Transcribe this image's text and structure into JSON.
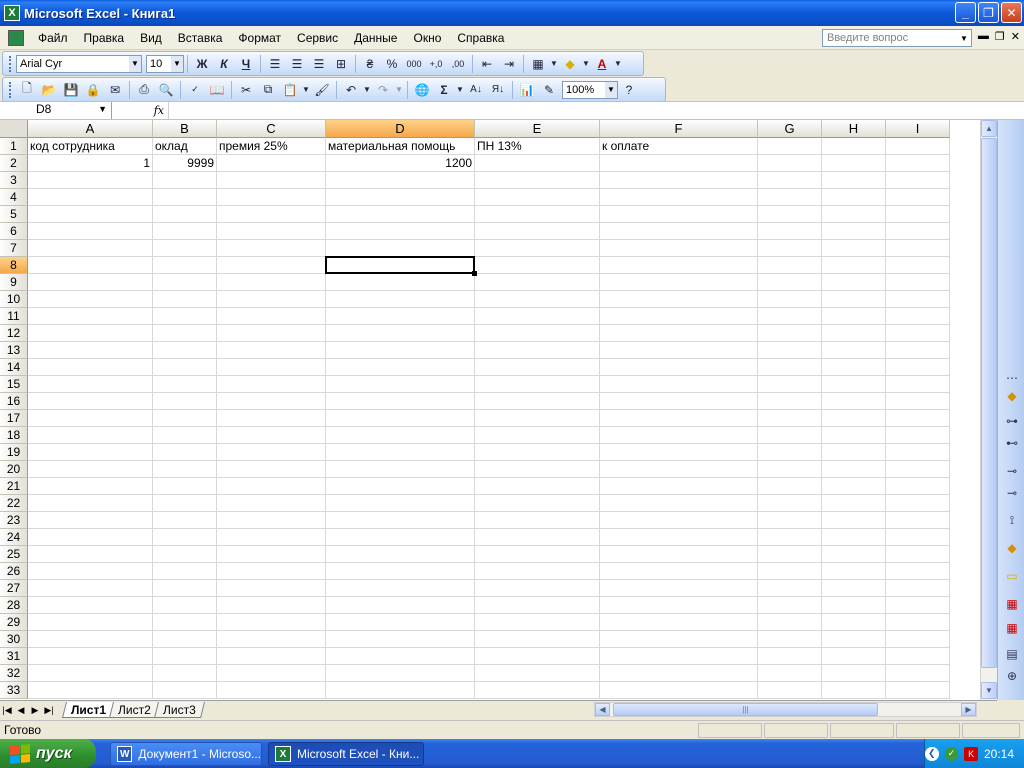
{
  "window": {
    "title": "Microsoft Excel - Книга1"
  },
  "menu": {
    "items": [
      "Файл",
      "Правка",
      "Вид",
      "Вставка",
      "Формат",
      "Сервис",
      "Данные",
      "Окно",
      "Справка"
    ],
    "help_placeholder": "Введите вопрос"
  },
  "format_toolbar": {
    "font": "Arial Cyr",
    "size": "10",
    "bold": "Ж",
    "italic": "К",
    "underline": "Ч",
    "percent": "%",
    "thousands": "000",
    "inc_decimal": "+,0",
    "dec_decimal": ",00",
    "font_color_glyph": "A"
  },
  "standard_toolbar": {
    "zoom": "100%",
    "sum_glyph": "Σ"
  },
  "formula_bar": {
    "name_box": "D8",
    "fx_label": "fx",
    "formula": ""
  },
  "sheet": {
    "columns": [
      "A",
      "B",
      "C",
      "D",
      "E",
      "F",
      "G",
      "H",
      "I"
    ],
    "active_column": "D",
    "active_row": 8,
    "row_count": 33,
    "cells": {
      "A1": "код сотрудника",
      "B1": "оклад",
      "C1": "премия 25%",
      "D1": "материальная помощь",
      "E1": "ПН 13%",
      "F1": "к оплате",
      "A2": "1",
      "B2": "9999",
      "D2": "1200"
    }
  },
  "tabs": [
    "Лист1",
    "Лист2",
    "Лист3"
  ],
  "active_tab": "Лист1",
  "status": {
    "text": "Готово"
  },
  "taskbar": {
    "start_label": "пуск",
    "buttons": [
      {
        "label": "Документ1 - Microso...",
        "icon": "W"
      },
      {
        "label": "Microsoft Excel - Кни...",
        "icon": "X"
      }
    ],
    "clock": "20:14"
  },
  "colors": {
    "title_blue": "#0a4fc8",
    "active_header": "#f4a84a",
    "excel_green": "#1d7a3a",
    "start_green": "#2d8d2d"
  }
}
